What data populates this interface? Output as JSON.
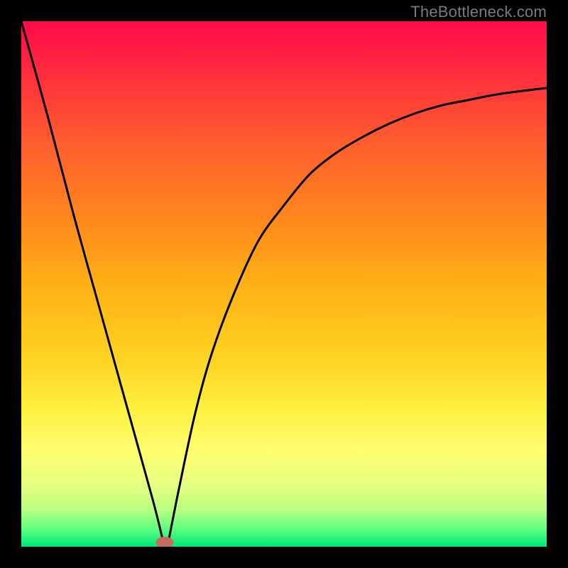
{
  "watermark": "TheBottleneck.com",
  "chart_data": {
    "type": "line",
    "title": "",
    "xlabel": "",
    "ylabel": "",
    "xlim": [
      0,
      100
    ],
    "ylim": [
      0,
      100
    ],
    "annotations": [],
    "series": [
      {
        "name": "left-branch",
        "x": [
          0,
          5,
          10,
          15,
          20,
          25,
          27
        ],
        "values": [
          100,
          82,
          63,
          45,
          27,
          9,
          1
        ]
      },
      {
        "name": "right-branch",
        "x": [
          28,
          30,
          33,
          36,
          40,
          45,
          50,
          55,
          60,
          65,
          70,
          75,
          80,
          85,
          90,
          95,
          100
        ],
        "values": [
          1,
          11,
          25,
          36,
          47,
          58,
          65,
          71,
          75,
          78,
          80.5,
          82.5,
          84,
          85,
          86,
          86.7,
          87.3
        ]
      }
    ],
    "marker": {
      "x": 27.3,
      "y": 0.8,
      "rx": 1.7,
      "ry": 1.1,
      "color": "#c76a5f"
    },
    "background_gradient": {
      "stops": [
        {
          "offset": 0.0,
          "color": "#ff0a4a"
        },
        {
          "offset": 0.1,
          "color": "#ff2d3d"
        },
        {
          "offset": 0.22,
          "color": "#ff5a2f"
        },
        {
          "offset": 0.35,
          "color": "#ff8020"
        },
        {
          "offset": 0.5,
          "color": "#ffb015"
        },
        {
          "offset": 0.63,
          "color": "#ffd020"
        },
        {
          "offset": 0.74,
          "color": "#fff040"
        },
        {
          "offset": 0.82,
          "color": "#ffff70"
        },
        {
          "offset": 0.88,
          "color": "#e8ff80"
        },
        {
          "offset": 0.93,
          "color": "#b8ff80"
        },
        {
          "offset": 0.965,
          "color": "#60ff80"
        },
        {
          "offset": 1.0,
          "color": "#00e676"
        }
      ]
    },
    "stroke": {
      "color": "#000000",
      "width": 3
    }
  }
}
